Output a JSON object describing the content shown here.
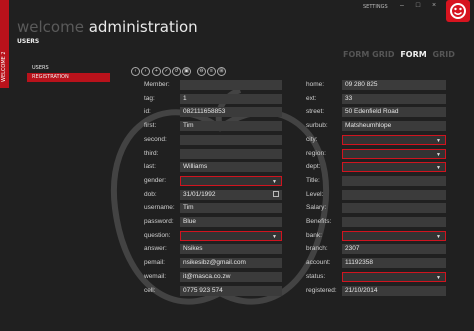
{
  "sidebar_tab": "WELCOME 2",
  "app": {
    "title_light": "welcome",
    "title_main": "administration",
    "subtitle": "USERS"
  },
  "settings_label": "SETTINGS",
  "window_controls": "– □ ×",
  "views": {
    "form_grid": "FORM GRID",
    "form": "FORM",
    "grid": "GRID"
  },
  "nav": [
    {
      "label": "USERS"
    },
    {
      "label": "REGISTRATION"
    }
  ],
  "toolbar": [
    "‹",
    "›",
    "+",
    "✓",
    "↺",
    "▣",
    "⊖",
    "≡",
    "⊞"
  ],
  "left_fields": [
    {
      "label": "Member:",
      "value": ""
    },
    {
      "label": "tag:",
      "value": "1"
    },
    {
      "label": "id:",
      "value": "082111658853"
    },
    {
      "label": "first:",
      "value": "Tim"
    },
    {
      "label": "second:",
      "value": ""
    },
    {
      "label": "third:",
      "value": ""
    },
    {
      "label": "last:",
      "value": "Williams"
    },
    {
      "label": "gender:",
      "value": ""
    },
    {
      "label": "dob:",
      "value": "31/01/1992"
    },
    {
      "label": "username:",
      "value": "Tim"
    },
    {
      "label": "password:",
      "value": "Blue"
    },
    {
      "label": "question:",
      "value": ""
    },
    {
      "label": "answer:",
      "value": "Nsikes"
    },
    {
      "label": "pemail:",
      "value": "nsikesibz@gmail.com"
    },
    {
      "label": "wemail:",
      "value": "it@masca.co.zw"
    },
    {
      "label": "cell:",
      "value": "0775 923 574"
    }
  ],
  "right_fields": [
    {
      "label": "home:",
      "value": "09 280 825"
    },
    {
      "label": "ext:",
      "value": "33"
    },
    {
      "label": "street:",
      "value": "50 Edenfield Road"
    },
    {
      "label": "surbub:",
      "value": "Matsheumhlope"
    },
    {
      "label": "city:",
      "value": ""
    },
    {
      "label": "region:",
      "value": ""
    },
    {
      "label": "dept:",
      "value": ""
    },
    {
      "label": "Title:",
      "value": ""
    },
    {
      "label": "Level:",
      "value": ""
    },
    {
      "label": "Salary:",
      "value": ""
    },
    {
      "label": "Benefits:",
      "value": ""
    },
    {
      "label": "bank:",
      "value": ""
    },
    {
      "label": "branch:",
      "value": "2307"
    },
    {
      "label": "account:",
      "value": "11192358"
    },
    {
      "label": "status:",
      "value": ""
    },
    {
      "label": "registered:",
      "value": "21/10/2014"
    }
  ],
  "colors": {
    "accent": "#d0141f",
    "background": "#202020",
    "field": "#3b3b3b"
  }
}
